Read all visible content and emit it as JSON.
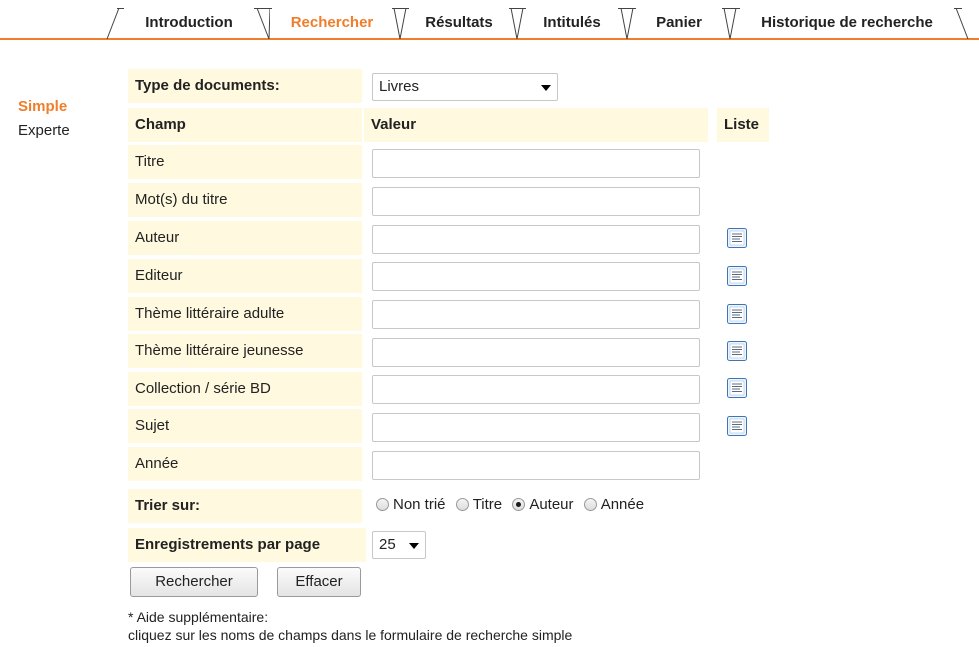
{
  "tabs": [
    {
      "label": "Introduction",
      "active": false
    },
    {
      "label": "Rechercher",
      "active": true
    },
    {
      "label": "Résultats",
      "active": false
    },
    {
      "label": "Intitulés",
      "active": false
    },
    {
      "label": "Panier",
      "active": false
    },
    {
      "label": "Historique de recherche",
      "active": false
    }
  ],
  "sidenav": {
    "simple": "Simple",
    "expert": "Experte"
  },
  "form": {
    "doc_type_label": "Type de documents:",
    "doc_type_value": "Livres",
    "header_champ": "Champ",
    "header_valeur": "Valeur",
    "header_liste": "Liste",
    "fields": [
      {
        "label": "Titre",
        "value": "",
        "has_list": false
      },
      {
        "label": "Mot(s) du titre",
        "value": "",
        "has_list": false
      },
      {
        "label": "Auteur",
        "value": "",
        "has_list": true
      },
      {
        "label": "Editeur",
        "value": "",
        "has_list": true
      },
      {
        "label": "Thème littéraire adulte",
        "value": "",
        "has_list": true
      },
      {
        "label": "Thème littéraire jeunesse",
        "value": "",
        "has_list": true
      },
      {
        "label": "Collection / série BD",
        "value": "",
        "has_list": true
      },
      {
        "label": "Sujet",
        "value": "",
        "has_list": true
      },
      {
        "label": "Année",
        "value": "",
        "has_list": false
      }
    ],
    "sort_label": "Trier sur:",
    "sort_options": [
      {
        "label": "Non trié",
        "checked": false
      },
      {
        "label": "Titre",
        "checked": false
      },
      {
        "label": "Auteur",
        "checked": true
      },
      {
        "label": "Année",
        "checked": false
      }
    ],
    "per_page_label": "Enregistrements par page",
    "per_page_value": "25",
    "search_button": "Rechercher",
    "clear_button": "Effacer"
  },
  "help": {
    "line1": "* Aide supplémentaire:",
    "line2": "cliquez sur les noms de champs dans le formulaire de recherche simple"
  },
  "colors": {
    "accent": "#f07d29",
    "label_bg": "#fef9df"
  }
}
